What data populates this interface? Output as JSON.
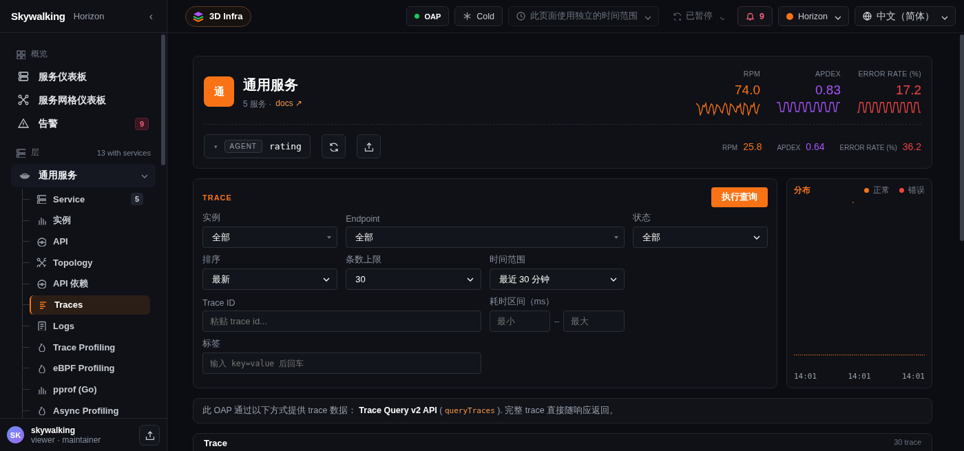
{
  "sidebar": {
    "logo": "Skywalking",
    "product": "Horizon",
    "collapse": "‹",
    "overview": {
      "label": "概览",
      "items": [
        {
          "label": "服务仪表板"
        },
        {
          "label": "服务网格仪表板"
        },
        {
          "label": "告警",
          "badge": "9"
        }
      ]
    },
    "layers": {
      "label": "层",
      "count": "13 with services",
      "group": {
        "label": "通用服务",
        "expanded": true,
        "children": [
          {
            "label": "Service",
            "badge": "5",
            "selected": false
          },
          {
            "label": "实例",
            "selected": false
          },
          {
            "label": "API",
            "selected": false
          },
          {
            "label": "Topology",
            "selected": false
          },
          {
            "label": "API 依赖",
            "selected": false
          },
          {
            "label": "Traces",
            "selected": true
          },
          {
            "label": "Logs",
            "selected": false
          },
          {
            "label": "Trace Profiling",
            "selected": false
          },
          {
            "label": "eBPF Profiling",
            "selected": false
          },
          {
            "label": "pprof (Go)",
            "selected": false
          },
          {
            "label": "Async Profiling",
            "selected": false
          }
        ]
      }
    },
    "user": {
      "initials": "SK",
      "name": "skywalking",
      "role": "viewer · maintainer"
    }
  },
  "topbar": {
    "project": "3D Infra",
    "oap": {
      "label": "OAP",
      "color": "#22c55e"
    },
    "cold": "Cold",
    "time_scope": "此页面使用独立的时间范围",
    "paused": "已暂停",
    "alerts": "9",
    "tenant": {
      "label": "Horizon",
      "color": "#f97316"
    },
    "language": "中文（简体）"
  },
  "service": {
    "avatar": "通",
    "title": "通用服务",
    "meta": "5 服务 ·",
    "docs": "docs ↗",
    "metrics": [
      {
        "label": "RPM",
        "value": "74.0",
        "color": "#f97316"
      },
      {
        "label": "APDEX",
        "value": "0.83",
        "color": "#a855f7"
      },
      {
        "label": "ERROR RATE (%)",
        "value": "17.2",
        "color": "#ef4444"
      }
    ],
    "selector": {
      "caret": "▾",
      "tag": "AGENT",
      "value": "rating"
    },
    "mini_metrics": [
      {
        "label": "RPM",
        "value": "25.8",
        "color": "#f97316"
      },
      {
        "label": "APDEX",
        "value": "0.64",
        "color": "#a855f7"
      },
      {
        "label": "ERROR RATE (%)",
        "value": "36.2",
        "color": "#ef4444"
      }
    ]
  },
  "trace_form": {
    "title": "TRACE",
    "run": "执行查询",
    "rows": [
      [
        {
          "kind": "combo",
          "label": "实例",
          "value": "全部"
        },
        {
          "kind": "combo",
          "label": "Endpoint",
          "value": "全部"
        },
        {
          "kind": "select",
          "label": "状态",
          "value": "全部"
        }
      ],
      [
        {
          "kind": "select",
          "label": "排序",
          "value": "最新"
        },
        {
          "kind": "select",
          "label": "条数上限",
          "value": "30"
        },
        {
          "kind": "select",
          "label": "时间范围",
          "value": "最近 30 分钟"
        }
      ],
      [
        {
          "kind": "input",
          "label": "Trace ID",
          "placeholder": "粘贴 trace id..."
        },
        {
          "kind": "range",
          "label": "耗时区间（ms）",
          "min_placeholder": "最小",
          "separator": "–",
          "max_placeholder": "最大"
        }
      ],
      [
        {
          "kind": "tag_input",
          "label": "标签",
          "placeholder": "输入 key=value 后回车"
        }
      ]
    ]
  },
  "distribution": {
    "title": "分布",
    "legend": [
      {
        "label": "正常",
        "color": "#f97316"
      },
      {
        "label": "错误",
        "color": "#ef4444"
      }
    ],
    "ticks": [
      "14:01",
      "14:01",
      "14:01"
    ]
  },
  "info": [
    {
      "kind": "text",
      "text": "此 OAP 通过以下方式提供 trace 数据： "
    },
    {
      "kind": "strong",
      "text": "Trace Query v2 API"
    },
    {
      "kind": "text",
      "text": " ( "
    },
    {
      "kind": "code",
      "text": "queryTraces"
    },
    {
      "kind": "text",
      "text": " ). 完整 trace 直接随响应返回。"
    }
  ],
  "results": {
    "title": "Trace",
    "count": "30 trace"
  }
}
